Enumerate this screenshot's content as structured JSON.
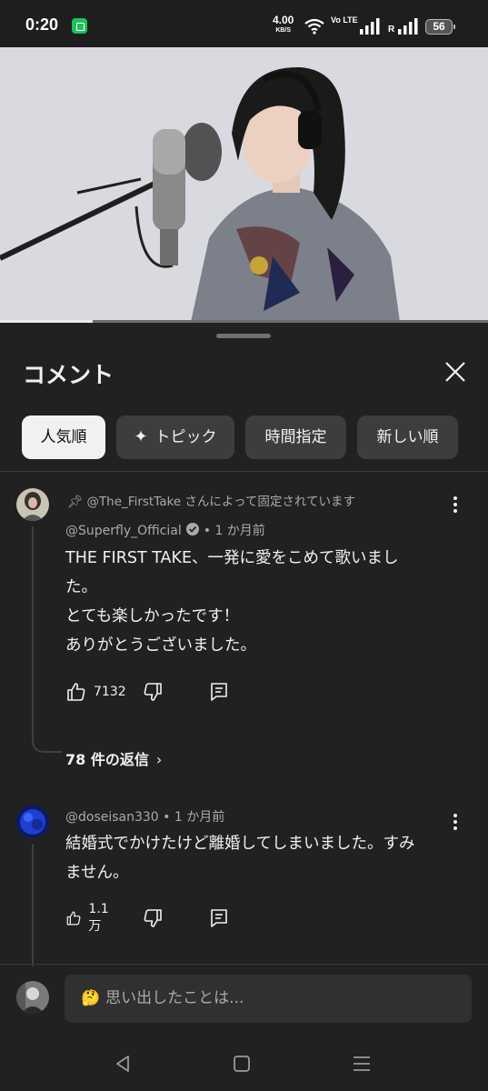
{
  "status_bar": {
    "time": "0:20",
    "speed_value": "4.00",
    "speed_unit": "KB/S",
    "volte": "Vo LTE",
    "roaming": "R",
    "battery": "56"
  },
  "video": {
    "progress_fraction": 0.19
  },
  "panel": {
    "title": "コメント",
    "chips": [
      {
        "label": "人気順",
        "active": true
      },
      {
        "label": "トピック",
        "active": false
      },
      {
        "label": "時間指定",
        "active": false
      },
      {
        "label": "新しい順",
        "active": false
      }
    ]
  },
  "comments": [
    {
      "pinned_by": "@The_FirstTake さんによって固定されています",
      "author": "@Superfly_Official",
      "time": "• 1 か月前",
      "lines": [
        "THE FIRST TAKE、一発に愛をこめて歌いまし",
        "た。",
        "とても楽しかったです！",
        "ありがとうございました。"
      ],
      "likes": "7132",
      "replies_label": "78 件の返信"
    },
    {
      "author": "@doseisan330",
      "time": "• 1 か月前",
      "lines": [
        "結婚式でかけたけど離婚してしまいました。すみ",
        "ません。"
      ],
      "likes": "1.1万"
    }
  ],
  "composer": {
    "emoji": "🤔",
    "placeholder": "思い出したことは..."
  },
  "colors": {
    "panel_bg": "#212121",
    "chip_active_bg": "#f1f1f1",
    "chip_bg": "#3d3d3d"
  }
}
